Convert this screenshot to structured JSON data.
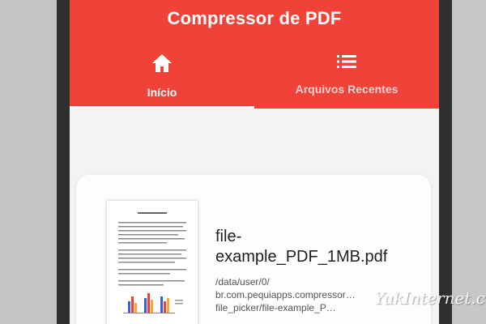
{
  "app": {
    "title": "Compressor de PDF"
  },
  "tabs": [
    {
      "label": "Início",
      "icon": "home-icon",
      "active": true
    },
    {
      "label": "Arquivos Recentes",
      "icon": "list-icon",
      "active": false
    }
  ],
  "file": {
    "name": "file-\nexample_PDF_1MB.pdf",
    "path": "/data/user/0/\nbr.com.pequiapps.compressor…\nfile_picker/file-example_P…"
  },
  "watermark": "YukInternet.com",
  "colors": {
    "primary": "#ef4339",
    "screen_bg": "#f3f3f3",
    "card_bg": "#fdfdfd"
  }
}
